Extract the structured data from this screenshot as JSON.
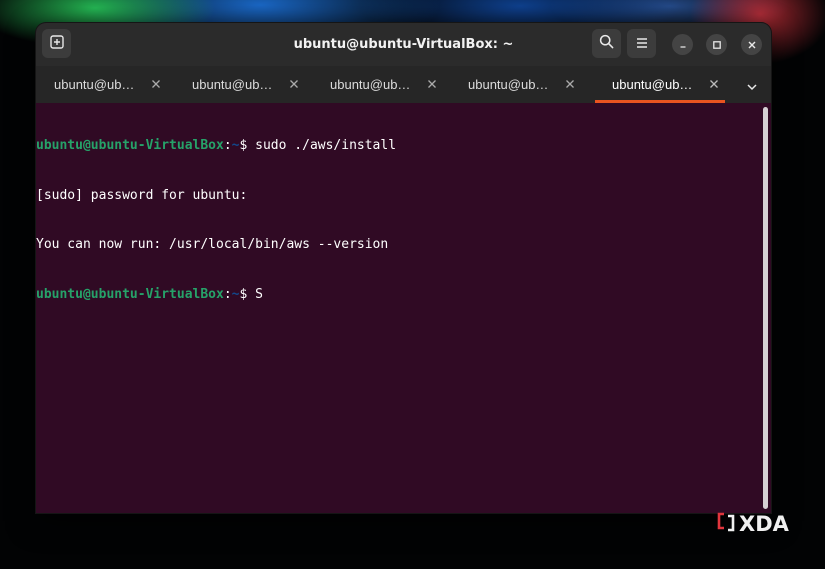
{
  "window": {
    "title": "ubuntu@ubuntu-VirtualBox: ~"
  },
  "tabs": [
    {
      "label": "ubuntu@ubuntu-VirtualBox: ~",
      "active": false
    },
    {
      "label": "ubuntu@ubuntu-VirtualBox: ~",
      "active": false
    },
    {
      "label": "ubuntu@ubuntu-VirtualBox: ~",
      "active": false
    },
    {
      "label": "ubuntu@ubuntu-VirtualBox: ~",
      "active": false
    },
    {
      "label": "ubuntu@ubuntu-VirtualBox: ~",
      "active": true
    }
  ],
  "terminal": {
    "lines": [
      {
        "type": "prompt",
        "user": "ubuntu@ubuntu-VirtualBox",
        "sep": ":",
        "path": "~",
        "symbol": "$",
        "command": "sudo ./aws/install"
      },
      {
        "type": "output",
        "text": "[sudo] password for ubuntu:"
      },
      {
        "type": "output",
        "text": "You can now run: /usr/local/bin/aws --version"
      },
      {
        "type": "prompt",
        "user": "ubuntu@ubuntu-VirtualBox",
        "sep": ":",
        "path": "~",
        "symbol": "$",
        "command": "S"
      }
    ]
  },
  "icons": {
    "new_tab": "new-tab-icon",
    "search": "search-icon",
    "menu": "hamburger-menu-icon",
    "minimize": "minimize-icon",
    "maximize": "maximize-icon",
    "close": "close-icon",
    "tab_close": "tab-close-icon",
    "tab_dropdown": "chevron-down-icon"
  },
  "colors": {
    "terminal_bg": "#300a24",
    "prompt_user": "#26a269",
    "prompt_path": "#12488b",
    "accent": "#e95420",
    "headerbar": "#2b2b2b",
    "tabbar": "#262626"
  },
  "watermark": {
    "text": "XDA"
  }
}
